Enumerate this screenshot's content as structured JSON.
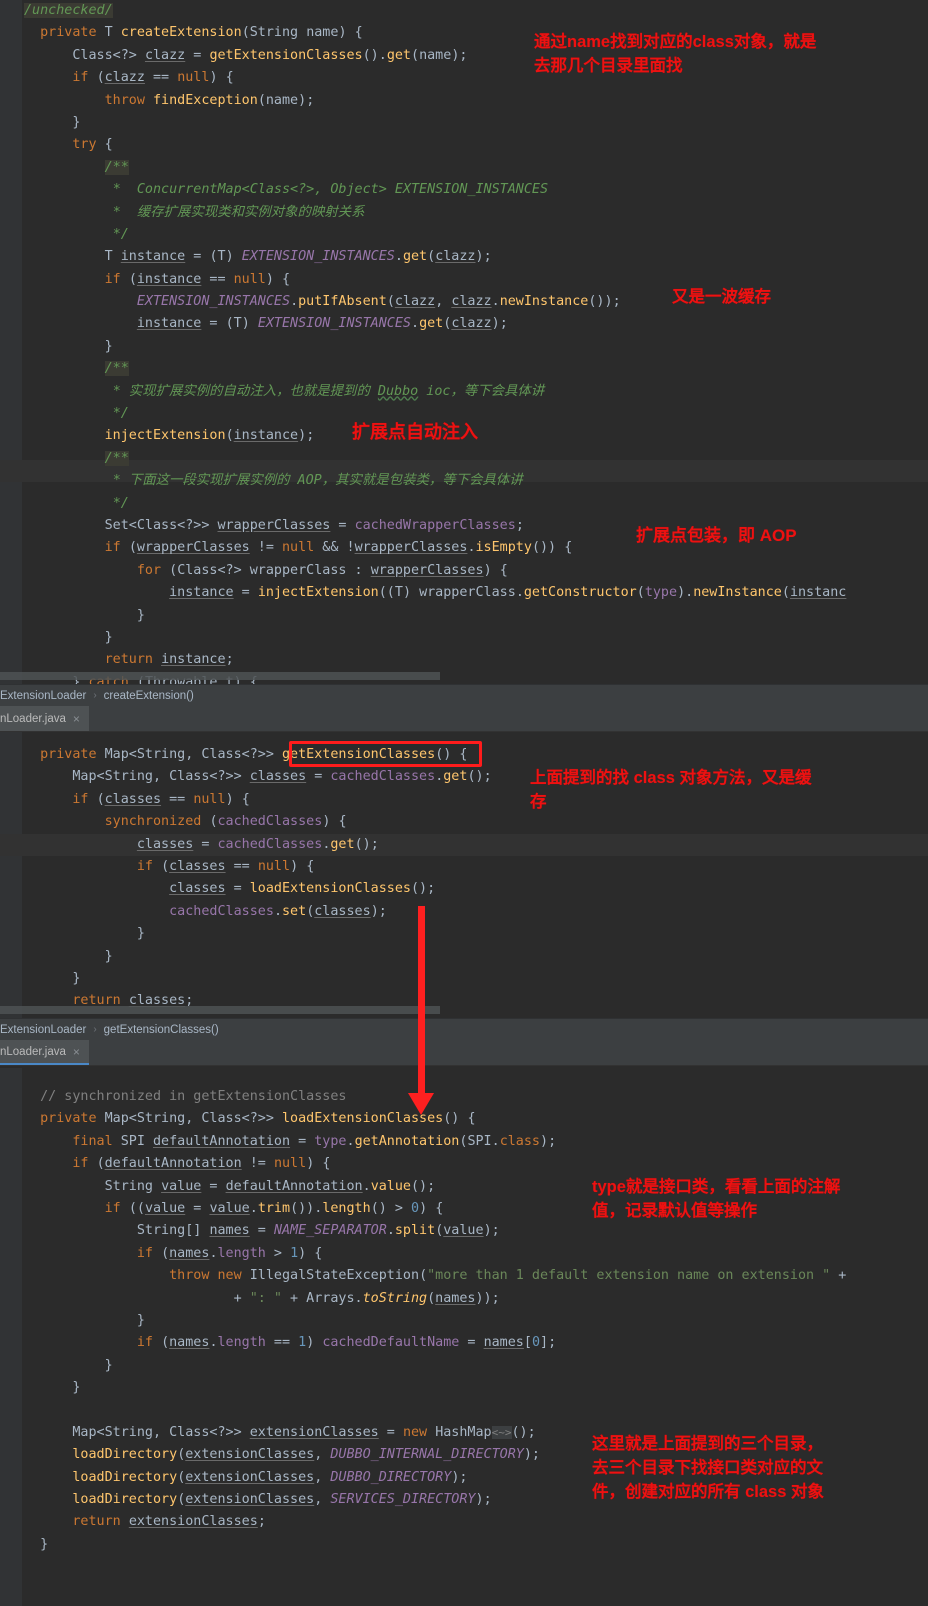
{
  "window": {
    "title": "ExtensionLoader.java",
    "theme": "darcula"
  },
  "panes": [
    {
      "id": "pane-create-extension",
      "breadcrumb": {
        "file_class": "ExtensionLoader",
        "separator": "›",
        "method": "createExtension()"
      },
      "tab": {
        "label": "nLoader.java",
        "close_glyph": "×",
        "active": false
      },
      "code_lines": [
        "/unchecked/",
        "private T createExtension(String name) {",
        "    Class<?> clazz = getExtensionClasses().get(name);",
        "    if (clazz == null) {",
        "        throw findException(name);",
        "    }",
        "    try {",
        "        /**",
        "         *  ConcurrentMap<Class<?>, Object> EXTENSION_INSTANCES",
        "         *  缓存扩展实现类和实例对象的映射关系",
        "         */",
        "        T instance = (T) EXTENSION_INSTANCES.get(clazz);",
        "        if (instance == null) {",
        "            EXTENSION_INSTANCES.putIfAbsent(clazz, clazz.newInstance());",
        "            instance = (T) EXTENSION_INSTANCES.get(clazz);",
        "        }",
        "        /**",
        "         * 实现扩展实例的自动注入，也就是提到的 Dubbo ioc，等下会具体讲",
        "         */",
        "        injectExtension(instance);",
        "        /**",
        "         * 下面这一段实现扩展实例的 AOP，其实就是包装类，等下会具体讲",
        "         */",
        "        Set<Class<?>> wrapperClasses = cachedWrapperClasses;",
        "        if (wrapperClasses != null && !wrapperClasses.isEmpty()) {",
        "            for (Class<?> wrapperClass : wrapperClasses) {",
        "                instance = injectExtension((T) wrapperClass.getConstructor(type).newInstance(instance",
        "            }",
        "        }",
        "        return instance;",
        "    } catch (Throwable t) {"
      ]
    },
    {
      "id": "pane-get-extension-classes",
      "breadcrumb": {
        "file_class": "ExtensionLoader",
        "separator": "›",
        "method": "getExtensionClasses()"
      },
      "tab": {
        "label": "nLoader.java",
        "close_glyph": "×",
        "active": false
      },
      "code_lines": [
        "private Map<String, Class<?>> getExtensionClasses() {",
        "    Map<String, Class<?>> classes = cachedClasses.get();",
        "    if (classes == null) {",
        "        synchronized (cachedClasses) {",
        "            classes = cachedClasses.get();",
        "            if (classes == null) {",
        "                classes = loadExtensionClasses();",
        "                cachedClasses.set(classes);",
        "            }",
        "        }",
        "    }",
        "    return classes;"
      ]
    },
    {
      "id": "pane-load-extension-classes",
      "tab": {
        "label": "nLoader.java",
        "close_glyph": "×",
        "active": true
      },
      "code_lines": [
        "// synchronized in getExtensionClasses",
        "private Map<String, Class<?>> loadExtensionClasses() {",
        "    final SPI defaultAnnotation = type.getAnnotation(SPI.class);",
        "    if (defaultAnnotation != null) {",
        "        String value = defaultAnnotation.value();",
        "        if ((value = value.trim()).length() > 0) {",
        "            String[] names = NAME_SEPARATOR.split(value);",
        "            if (names.length > 1) {",
        "                throw new IllegalStateException(\"more than 1 default extension name on extension \" +",
        "                        + \": \" + Arrays.toString(names));",
        "            }",
        "            if (names.length == 1) cachedDefaultName = names[0];",
        "        }",
        "    }",
        "",
        "    Map<String, Class<?>> extensionClasses = new HashMap<~>();",
        "    loadDirectory(extensionClasses, DUBBO_INTERNAL_DIRECTORY);",
        "    loadDirectory(extensionClasses, DUBBO_DIRECTORY);",
        "    loadDirectory(extensionClasses, SERVICES_DIRECTORY);",
        "    return extensionClasses;",
        "}"
      ]
    }
  ],
  "annotations": {
    "color": "#ee1111",
    "notes": [
      {
        "id": "note-find-class-by-name",
        "text": "通过name找到对应的class对象，就是\n去那几个目录里面找"
      },
      {
        "id": "note-cache-again",
        "text": "又是一波缓存"
      },
      {
        "id": "note-auto-inject",
        "text": "扩展点自动注入"
      },
      {
        "id": "note-wrapper-aop",
        "text": "扩展点包装，即 AOP"
      },
      {
        "id": "note-find-class-method",
        "text": "上面提到的找 class 对象方法，又是缓\n存"
      },
      {
        "id": "note-type-is-interface",
        "text": "type就是接口类，看看上面的注解\n值，记录默认值等操作"
      },
      {
        "id": "note-three-directories",
        "text": "这里就是上面提到的三个目录，\n去三个目录下找接口类对应的文\n件，创建对应的所有 class 对象"
      }
    ],
    "highlight_box": {
      "id": "box-get-extension-classes",
      "target": "getExtensionClasses()"
    },
    "arrow": {
      "id": "arrow-to-load-extension-classes",
      "direction": "down"
    }
  }
}
